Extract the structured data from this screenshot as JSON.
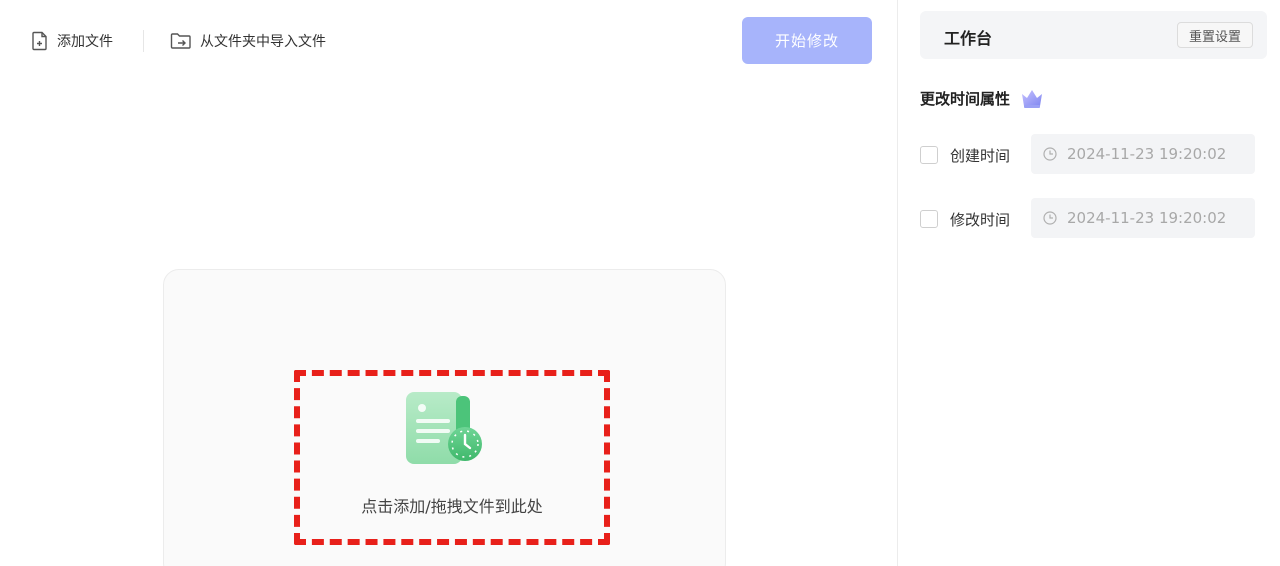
{
  "toolbar": {
    "add_file_label": "添加文件",
    "import_folder_label": "从文件夹中导入文件",
    "start_button_label": "开始修改"
  },
  "dropzone": {
    "label": "点击添加/拖拽文件到此处"
  },
  "panel": {
    "title": "工作台",
    "reset_label": "重置设置",
    "section_title": "更改时间属性",
    "rows": [
      {
        "label": "创建时间",
        "value": "2024-11-23 19:20:02",
        "checked": false
      },
      {
        "label": "修改时间",
        "value": "2024-11-23 19:20:02",
        "checked": false
      }
    ]
  },
  "colors": {
    "accent": "#a7b4fb",
    "highlight": "#e8201a",
    "icon_green": "#4cc47a"
  },
  "icons": {
    "add_file": "file-add-icon",
    "import_folder": "folder-import-icon",
    "crown": "crown-icon",
    "clock": "clock-icon",
    "dropzone": "document-clock-icon"
  }
}
